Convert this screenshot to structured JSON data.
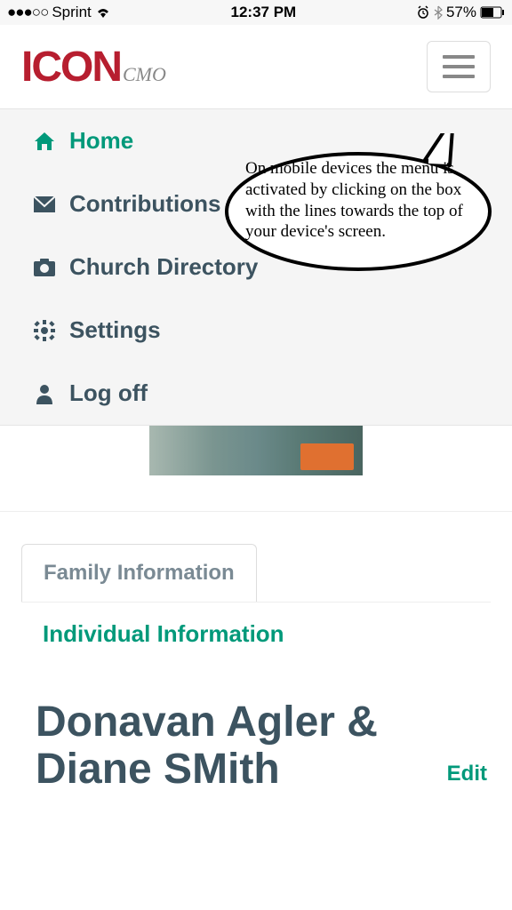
{
  "status": {
    "carrier": "Sprint",
    "time": "12:37 PM",
    "battery": "57%"
  },
  "logo": {
    "main": "ICON",
    "sub": "CMO"
  },
  "menu": {
    "home": "Home",
    "contributions": "Contributions",
    "directory": "Church Directory",
    "settings": "Settings",
    "logoff": "Log off"
  },
  "tabs": {
    "family": "Family Information",
    "individual": "Individual Information"
  },
  "family": {
    "name": "Donavan Agler & Diane SMith",
    "edit": "Edit"
  },
  "callout": {
    "text": "On mobile devices the menu is activated by clicking on the box with the lines towards the top of your device's screen."
  }
}
